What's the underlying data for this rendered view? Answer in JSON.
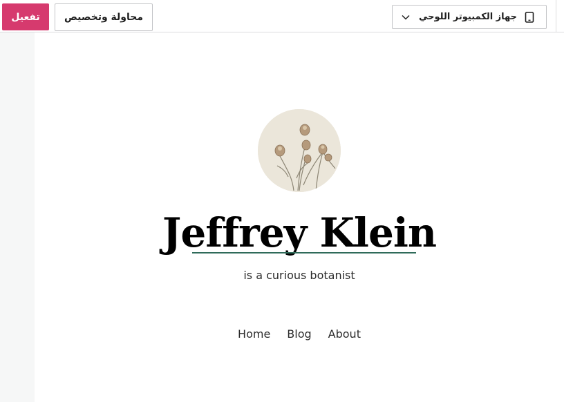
{
  "toolbar": {
    "activate_label": "تفعيل",
    "try_customize_label": "محاولة وتخصيص",
    "device_preview_label": "جهاز الكمبيوتر اللوحي",
    "colors": {
      "activate_bg": "#d63a6e",
      "border": "#c3c4c7"
    }
  },
  "preview": {
    "site_title": "Jeffrey Klein",
    "tagline": "is a curious botanist",
    "nav": [
      "Home",
      "Blog",
      "About"
    ],
    "colors": {
      "title_underline": "#2f6b5a",
      "avatar_bg": "#ebe6da"
    }
  },
  "icons": {
    "device": "tablet-icon",
    "dropdown": "chevron-down-icon",
    "avatar": "dried-flowers-image"
  }
}
